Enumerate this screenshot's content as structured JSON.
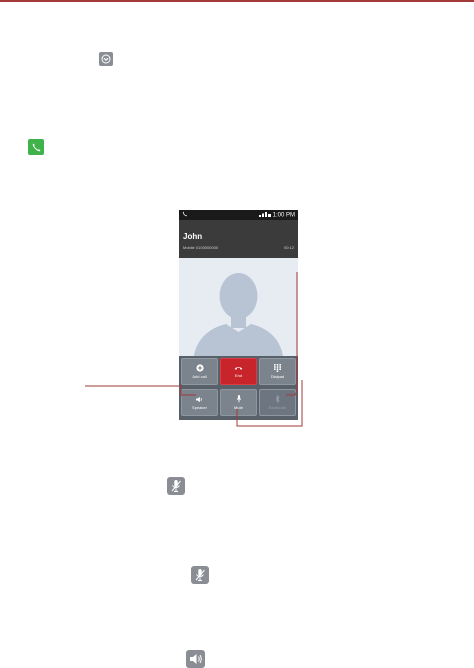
{
  "icons": {
    "chevron": "chevron-down-icon",
    "phone": "phone-icon",
    "mute": "mute-icon",
    "speaker": "speaker-icon"
  },
  "phone_screen": {
    "status_bar": {
      "left": "",
      "time": "1:00 PM"
    },
    "caller": {
      "name": "John",
      "label": "Mobile 0100000000",
      "timer": "00:12"
    },
    "buttons": [
      {
        "label": "Add call",
        "icon": "add-call-icon"
      },
      {
        "label": "End",
        "icon": "end-call-icon"
      },
      {
        "label": "Dialpad",
        "icon": "dialpad-icon"
      },
      {
        "label": "Speaker",
        "icon": "speaker-icon"
      },
      {
        "label": "Mute",
        "icon": "mute-icon"
      },
      {
        "label": "Bluetooth",
        "icon": "bluetooth-icon"
      }
    ]
  },
  "colors": {
    "accent": "#a33a3a",
    "end_red": "#c8242c",
    "phone_green": "#3fb24a",
    "button_gray": "#7b838d"
  }
}
